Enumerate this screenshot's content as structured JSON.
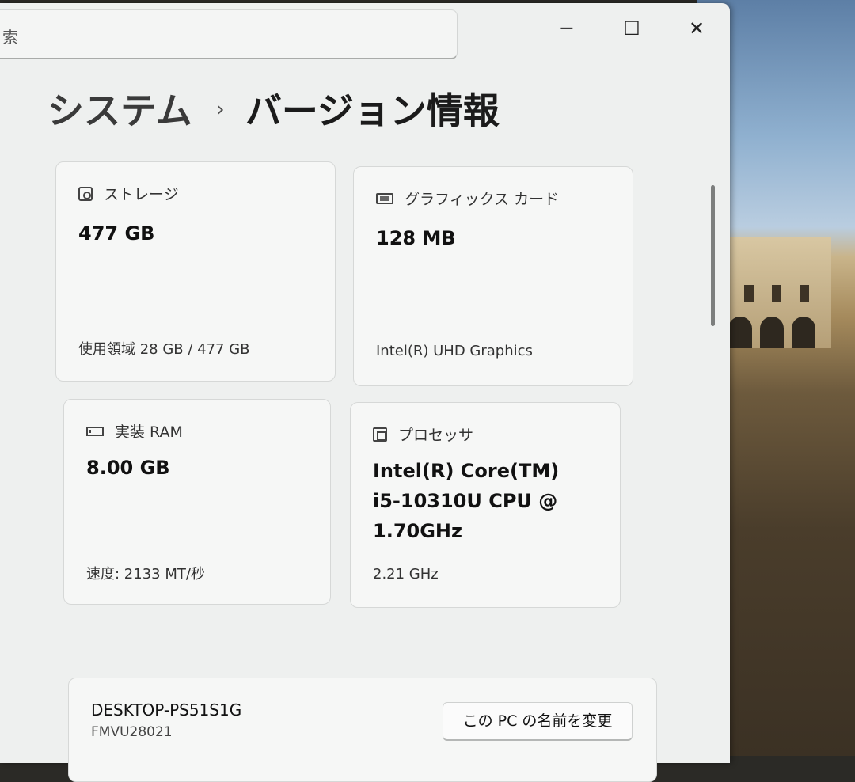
{
  "window": {
    "search_text": "索",
    "minimize_glyph": "─",
    "maximize_glyph": "☐",
    "close_glyph": "✕"
  },
  "breadcrumb": {
    "parent": "システム",
    "separator": "›",
    "current": "バージョン情報"
  },
  "specs": {
    "storage": {
      "label": "ストレージ",
      "value": "477 GB",
      "detail": "使用領域 28 GB / 477 GB",
      "icon": "hard-drive-icon"
    },
    "graphics": {
      "label": "グラフィックス カード",
      "value": "128 MB",
      "detail": "Intel(R) UHD Graphics",
      "icon": "graphics-card-icon"
    },
    "ram": {
      "label": "実装 RAM",
      "value": "8.00 GB",
      "detail": "速度: 2133 MT/秒",
      "icon": "ram-icon"
    },
    "processor": {
      "label": "プロセッサ",
      "value_lines": [
        "Intel(R) Core(TM)",
        "i5-10310U CPU @",
        "1.70GHz"
      ],
      "detail": "2.21 GHz",
      "icon": "processor-icon"
    }
  },
  "device": {
    "name": "DESKTOP-PS51S1G",
    "model": "FMVU28021",
    "rename_label": "この PC の名前を変更"
  },
  "colors": {
    "window_bg": "#eef0ef",
    "card_bg": "#f6f7f6",
    "card_border": "#d6d8d7"
  }
}
